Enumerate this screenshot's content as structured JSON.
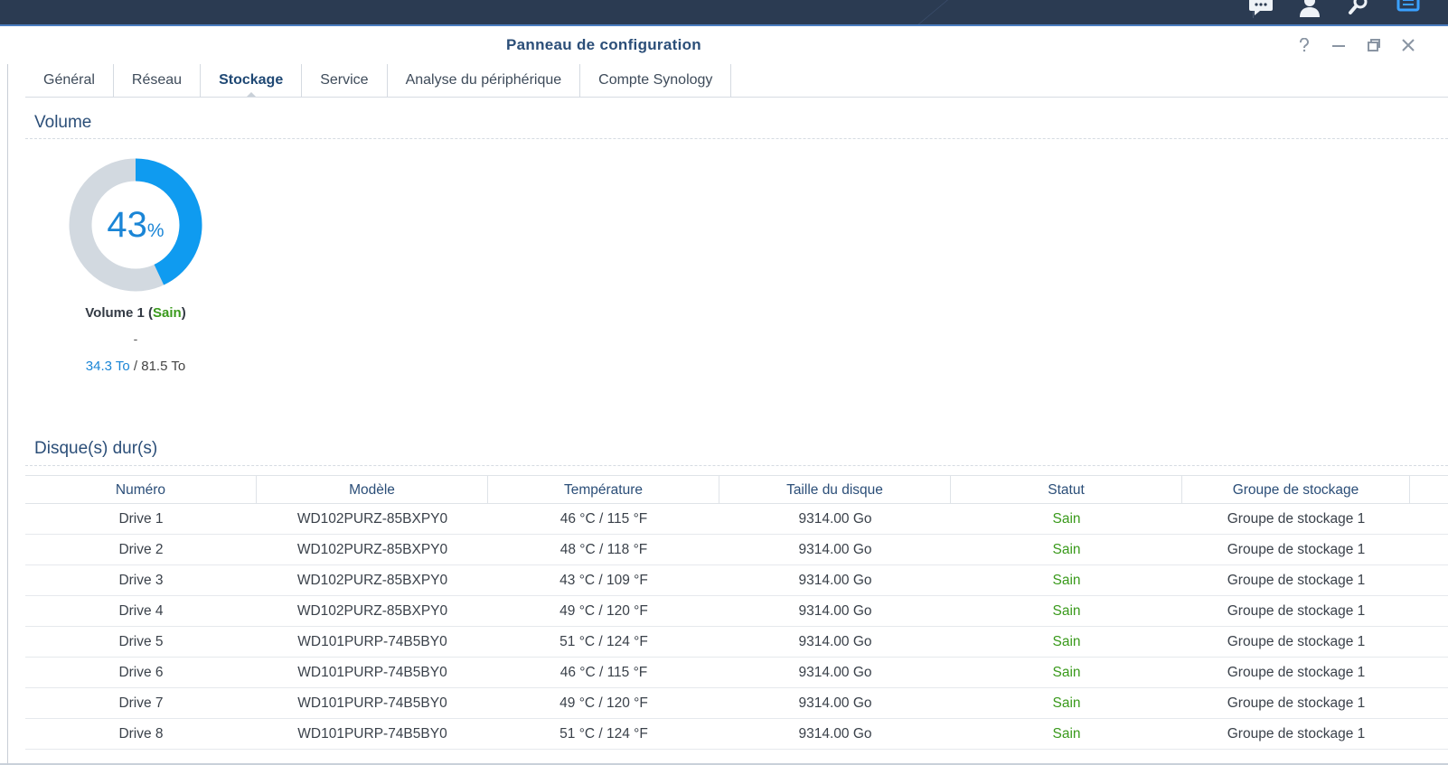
{
  "window": {
    "title": "Panneau de configuration"
  },
  "taskbar": {
    "icons": [
      "chat-icon",
      "user-icon",
      "search-icon",
      "widgets-icon"
    ]
  },
  "tabs": [
    {
      "label": "Général",
      "active": false
    },
    {
      "label": "Réseau",
      "active": false
    },
    {
      "label": "Stockage",
      "active": true
    },
    {
      "label": "Service",
      "active": false
    },
    {
      "label": "Analyse du périphérique",
      "active": false
    },
    {
      "label": "Compte Synology",
      "active": false
    }
  ],
  "volume_section": {
    "title": "Volume",
    "usage_percent": 43,
    "usage_number": "43",
    "usage_unit": "%",
    "name": "Volume 1",
    "status": "Sain",
    "description": "-",
    "used": "34.3 To",
    "separator": " / ",
    "total": "81.5 To",
    "colors": {
      "used": "#0f9bf0",
      "free": "#d2d9e0",
      "status": "#3a9a1c"
    }
  },
  "disks_section": {
    "title": "Disque(s) dur(s)",
    "columns": [
      "Numéro",
      "Modèle",
      "Température",
      "Taille du disque",
      "Statut",
      "Groupe de stockage"
    ],
    "rows": [
      [
        "Drive 1",
        "WD102PURZ-85BXPY0",
        "46 °C / 115 °F",
        "9314.00 Go",
        "Sain",
        "Groupe de stockage 1"
      ],
      [
        "Drive 2",
        "WD102PURZ-85BXPY0",
        "48 °C / 118 °F",
        "9314.00 Go",
        "Sain",
        "Groupe de stockage 1"
      ],
      [
        "Drive 3",
        "WD102PURZ-85BXPY0",
        "43 °C / 109 °F",
        "9314.00 Go",
        "Sain",
        "Groupe de stockage 1"
      ],
      [
        "Drive 4",
        "WD102PURZ-85BXPY0",
        "49 °C / 120 °F",
        "9314.00 Go",
        "Sain",
        "Groupe de stockage 1"
      ],
      [
        "Drive 5",
        "WD101PURP-74B5BY0",
        "51 °C / 124 °F",
        "9314.00 Go",
        "Sain",
        "Groupe de stockage 1"
      ],
      [
        "Drive 6",
        "WD101PURP-74B5BY0",
        "46 °C / 115 °F",
        "9314.00 Go",
        "Sain",
        "Groupe de stockage 1"
      ],
      [
        "Drive 7",
        "WD101PURP-74B5BY0",
        "49 °C / 120 °F",
        "9314.00 Go",
        "Sain",
        "Groupe de stockage 1"
      ],
      [
        "Drive 8",
        "WD101PURP-74B5BY0",
        "51 °C / 124 °F",
        "9314.00 Go",
        "Sain",
        "Groupe de stockage 1"
      ]
    ]
  }
}
